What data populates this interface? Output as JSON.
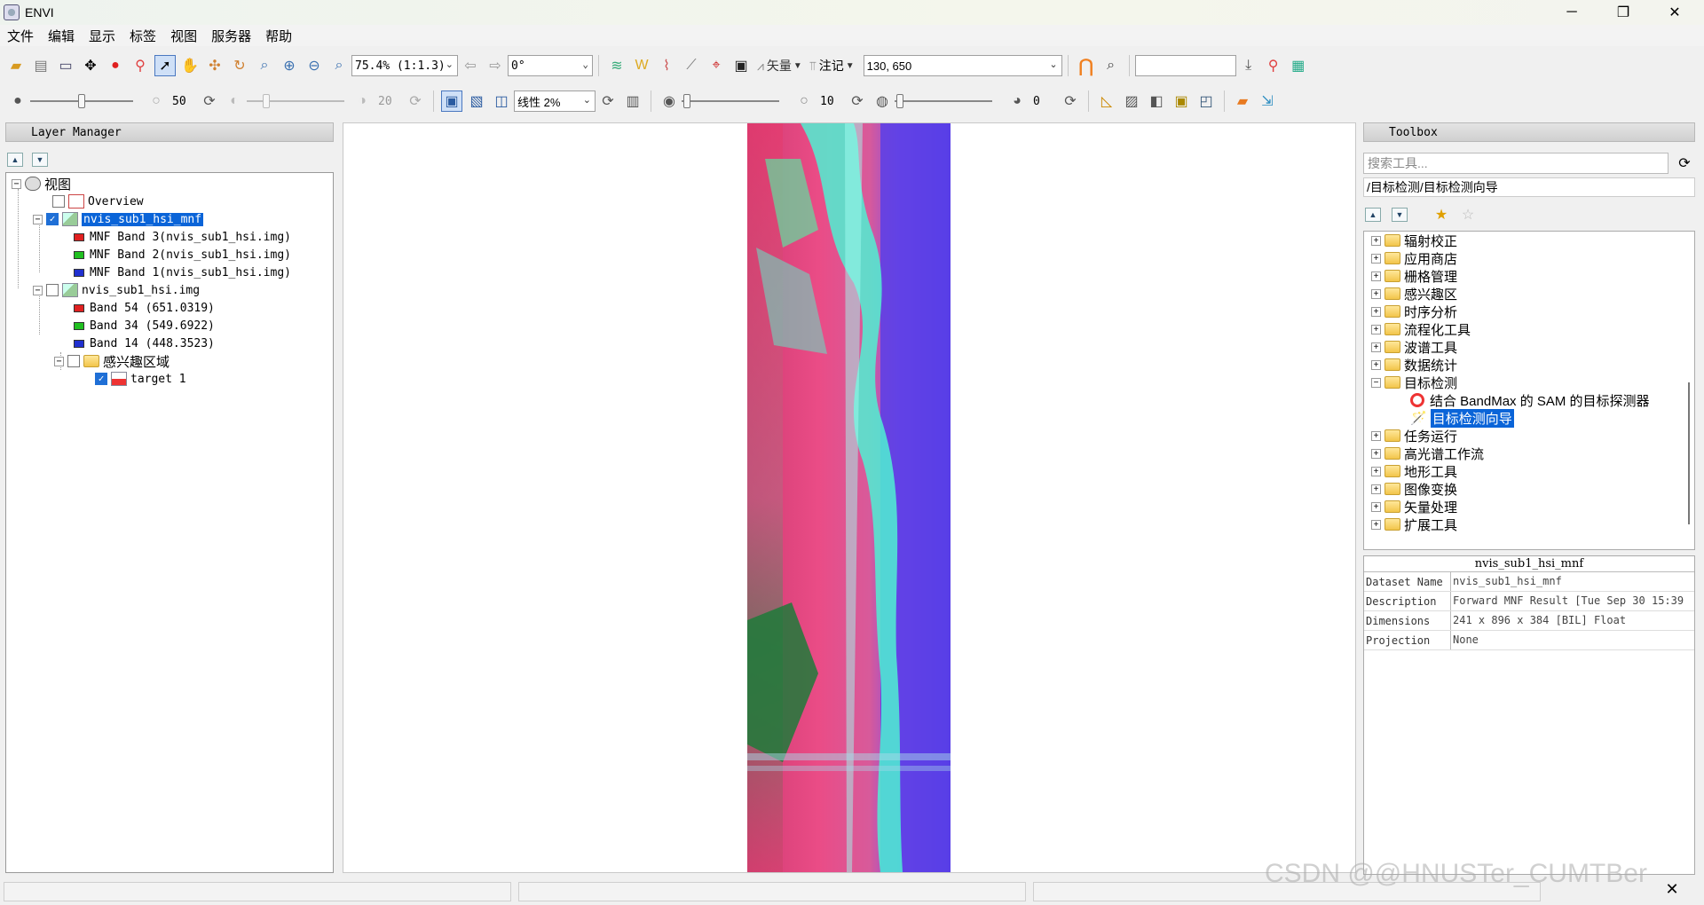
{
  "window": {
    "title": "ENVI",
    "minimize": "─",
    "maximize": "❐",
    "close": "✕"
  },
  "menu": [
    "文件",
    "编辑",
    "显示",
    "标签",
    "视图",
    "服务器",
    "帮助"
  ],
  "toolbar1": {
    "zoom_value": "75.4% (1:1.3)",
    "rotation_value": "0°",
    "vector_label": "矢量",
    "annotation_label": "注记",
    "coordinate_value": "130, 650",
    "quick_search_value": ""
  },
  "toolbar2": {
    "brightness_value": "50",
    "contrast_value": "20",
    "stretch_value": "线性 2%",
    "sharpen_value": "10",
    "transparency_value": "0"
  },
  "layer_manager": {
    "title": "Layer Manager",
    "root": "视图",
    "overview": "Overview",
    "layer1": {
      "name": "nvis_sub1_hsi_mnf",
      "checked": true,
      "bands": [
        {
          "label": "MNF Band 3(nvis_sub1_hsi.img)",
          "color": "#e02020"
        },
        {
          "label": "MNF Band 2(nvis_sub1_hsi.img)",
          "color": "#20c020"
        },
        {
          "label": "MNF Band 1(nvis_sub1_hsi.img)",
          "color": "#2030d0"
        }
      ]
    },
    "layer2": {
      "name": "nvis_sub1_hsi.img",
      "checked": false,
      "bands": [
        {
          "label": "Band 54  (651.0319)",
          "color": "#e02020"
        },
        {
          "label": "Band 34  (549.6922)",
          "color": "#20c020"
        },
        {
          "label": "Band 14  (448.3523)",
          "color": "#2030d0"
        }
      ]
    },
    "roi_folder": "感兴趣区域",
    "roi_item": "target 1"
  },
  "toolbox": {
    "title": "Toolbox",
    "search_placeholder": "搜索工具...",
    "path": "/目标检测/目标检测向导",
    "folders_before": [
      "辐射校正",
      "应用商店",
      "栅格管理",
      "感兴趣区",
      "时序分析",
      "流程化工具",
      "波谱工具",
      "数据统计"
    ],
    "open_folder": "目标检测",
    "children": [
      "结合 BandMax 的 SAM 的目标探测器",
      "目标检测向导"
    ],
    "folders_after": [
      "任务运行",
      "高光谱工作流",
      "地形工具",
      "图像变换",
      "矢量处理",
      "扩展工具"
    ]
  },
  "properties": {
    "header": "nvis_sub1_hsi_mnf",
    "rows": [
      {
        "key": "Dataset Name",
        "value": "nvis_sub1_hsi_mnf"
      },
      {
        "key": "Description",
        "value": "Forward MNF Result [Tue Sep 30 15:39"
      },
      {
        "key": "Dimensions",
        "value": "241 x 896 x 384 [BIL] Float"
      },
      {
        "key": "Projection",
        "value": "None"
      }
    ]
  },
  "watermark": "CSDN @@HNUSTer_CUMTBer",
  "colors": {
    "selection": "#0a64d8",
    "accent_orange": "#f08020"
  }
}
